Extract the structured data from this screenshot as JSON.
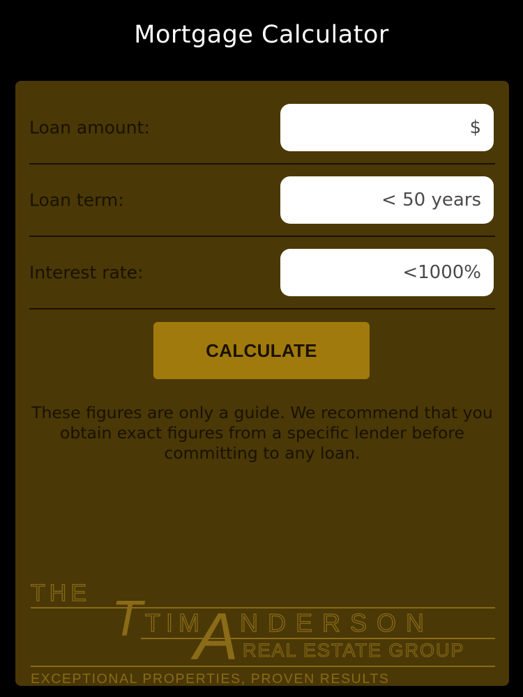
{
  "header": {
    "title": "Mortgage Calculator"
  },
  "form": {
    "loan_amount": {
      "label": "Loan amount:",
      "placeholder": "$",
      "value": ""
    },
    "loan_term": {
      "label": "Loan term:",
      "placeholder": "< 50 years",
      "value": ""
    },
    "interest_rate": {
      "label": "Interest rate:",
      "placeholder": "<1000%",
      "value": ""
    },
    "calculate_label": "CALCULATE"
  },
  "disclaimer": "These figures are only a guide. We recommend that you obtain exact figures from a specific lender before committing to any loan.",
  "logo": {
    "the": "THE",
    "tim": "TIM",
    "a": "A",
    "nderson": "NDERSON",
    "real_estate_group": "REAL ESTATE GROUP",
    "tagline": "EXCEPTIONAL PROPERTIES, PROVEN RESULTS"
  },
  "colors": {
    "background": "#000000",
    "panel": "#4a3806",
    "button": "#a07a0c",
    "logo_gold": "#8a6b17",
    "text_dark": "#1a1200",
    "title_text": "#ffffff"
  }
}
